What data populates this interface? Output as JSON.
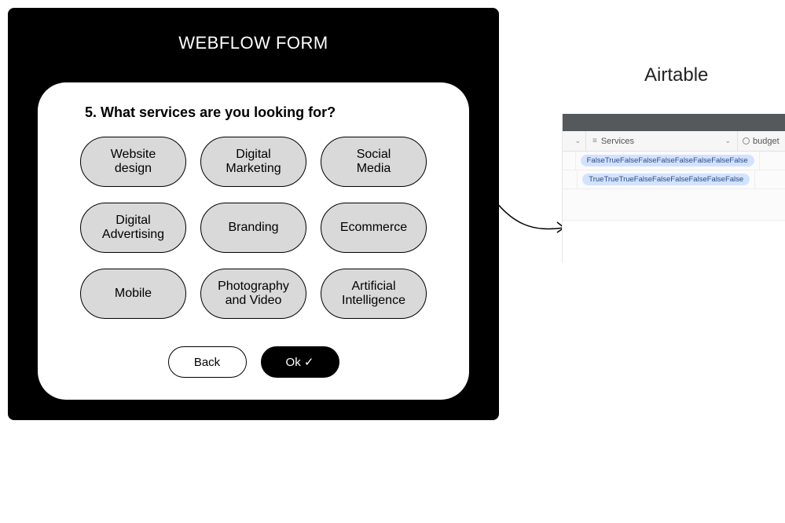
{
  "webflow": {
    "title": "WEBFLOW FORM",
    "question": "5.  What services are you looking for?",
    "options": [
      "Website\ndesign",
      "Digital\nMarketing",
      "Social\nMedia",
      "Digital\nAdvertising",
      "Branding",
      "Ecommerce",
      "Mobile",
      "Photography\nand Video",
      "Artificial\nIntelligence"
    ],
    "back_label": "Back",
    "ok_label": "Ok ✓"
  },
  "airtable": {
    "title": "Airtable",
    "columns": {
      "services": "Services",
      "budget": "budget"
    },
    "rows": [
      "FalseTrueFalseFalseFalseFalseFalseFalseFalse",
      "TrueTrueTrueFalseFalseFalseFalseFalseFalse"
    ]
  }
}
